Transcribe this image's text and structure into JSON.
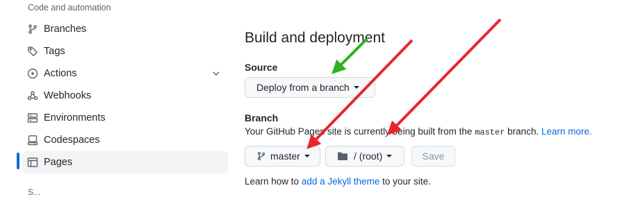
{
  "sidebar": {
    "section_title": "Code and automation",
    "items": [
      {
        "label": "Branches",
        "icon": "git-branch-icon"
      },
      {
        "label": "Tags",
        "icon": "tag-icon"
      },
      {
        "label": "Actions",
        "icon": "play-circle-icon"
      },
      {
        "label": "Webhooks",
        "icon": "webhook-icon"
      },
      {
        "label": "Environments",
        "icon": "server-icon"
      },
      {
        "label": "Codespaces",
        "icon": "codespaces-icon"
      },
      {
        "label": "Pages",
        "icon": "browser-icon",
        "active": true
      }
    ],
    "next_section_partial": "S..."
  },
  "main": {
    "title": "Build and deployment",
    "source_label": "Source",
    "source_button": "Deploy from a branch",
    "branch_label": "Branch",
    "desc_prefix": "Your GitHub Pages site is currently being built from the",
    "desc_branch": "master",
    "desc_suffix": "branch.",
    "learn_more": "Learn more.",
    "branch_button": "master",
    "folder_button": "/ (root)",
    "save_button": "Save",
    "jekyll_prefix": "Learn how to",
    "jekyll_link": "add a Jekyll theme",
    "jekyll_suffix": "to your site."
  },
  "colors": {
    "accent": "#0969da",
    "arrow_red": "#e8262a",
    "arrow_green": "#2bb41c"
  }
}
